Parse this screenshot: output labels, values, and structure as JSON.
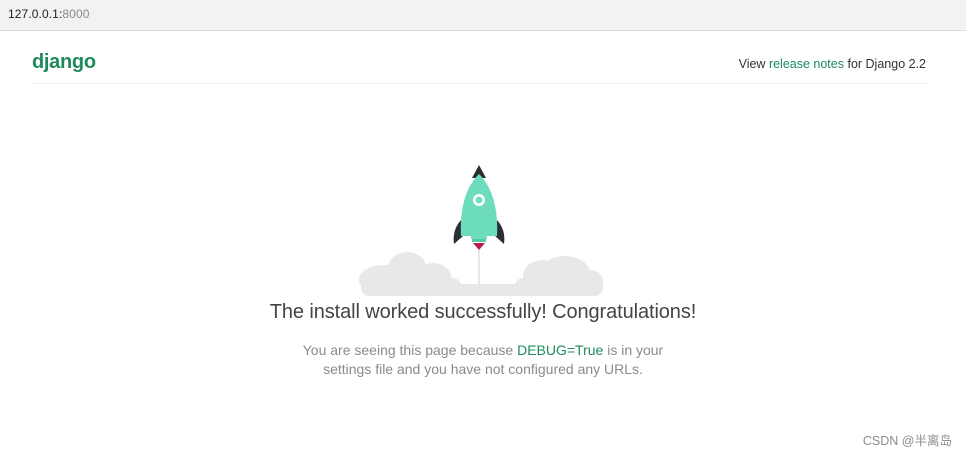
{
  "browser": {
    "url_host": "127.0.0.1:",
    "url_port": "8000"
  },
  "header": {
    "logo": "django",
    "release_prefix": "View ",
    "release_link": "release notes",
    "release_suffix": " for Django 2.2"
  },
  "main": {
    "headline": "The install worked successfully! Congratulations!",
    "desc_prefix": "You are seeing this page because ",
    "desc_code": "DEBUG=True",
    "desc_suffix": " is in your settings file and you have not configured any URLs."
  },
  "watermark": "CSDN @半离岛",
  "colors": {
    "brand_green": "#1f8a5a",
    "link_green": "#1e8a5b",
    "rocket_body": "#6ddcbd",
    "rocket_fin": "#2b2f33",
    "flame": "#b81d4b",
    "cloud": "#e8e8ea"
  },
  "icons": {
    "rocket": "rocket-icon",
    "clouds": "cloud-icon"
  }
}
